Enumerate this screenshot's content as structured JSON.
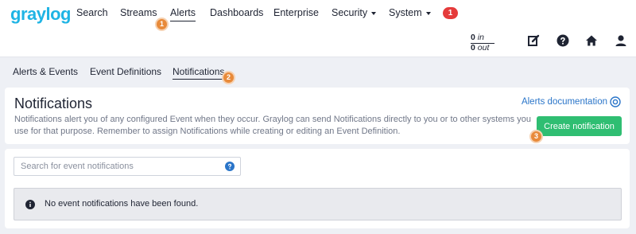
{
  "brand": {
    "logo_text": "graylog",
    "color": "#1fb4e4"
  },
  "nav": {
    "items": [
      {
        "label": "Search"
      },
      {
        "label": "Streams"
      },
      {
        "label": "Alerts"
      },
      {
        "label": "Dashboards"
      },
      {
        "label": "Enterprise"
      },
      {
        "label": "Security"
      },
      {
        "label": "System"
      }
    ],
    "active": "Alerts",
    "notification_count": "1",
    "throughput": {
      "in_value": "0",
      "in_label": "in",
      "out_value": "0",
      "out_label": "out"
    },
    "icons": [
      "edit-icon",
      "help-icon",
      "home-icon",
      "user-icon"
    ]
  },
  "steps": {
    "one": "1",
    "two": "2",
    "three": "3"
  },
  "subnav": {
    "items": [
      {
        "label": "Alerts & Events"
      },
      {
        "label": "Event Definitions"
      },
      {
        "label": "Notifications"
      }
    ],
    "active": "Notifications"
  },
  "header": {
    "title": "Notifications",
    "description": "Notifications alert you of any configured Event when they occur. Graylog can send Notifications directly to you or to other systems you use for that purpose. Remember to assign Notifications while creating or editing an Event Definition.",
    "docs_link": "Alerts documentation",
    "create_button": "Create notification"
  },
  "search": {
    "placeholder": "Search for event notifications",
    "value": ""
  },
  "empty_state": {
    "message": "No event notifications have been found."
  },
  "colors": {
    "accent": "#1fb4e4",
    "success": "#2fbe72",
    "danger": "#e53b3b",
    "step_badge": "#e88a3a",
    "link": "#2a75c9"
  }
}
